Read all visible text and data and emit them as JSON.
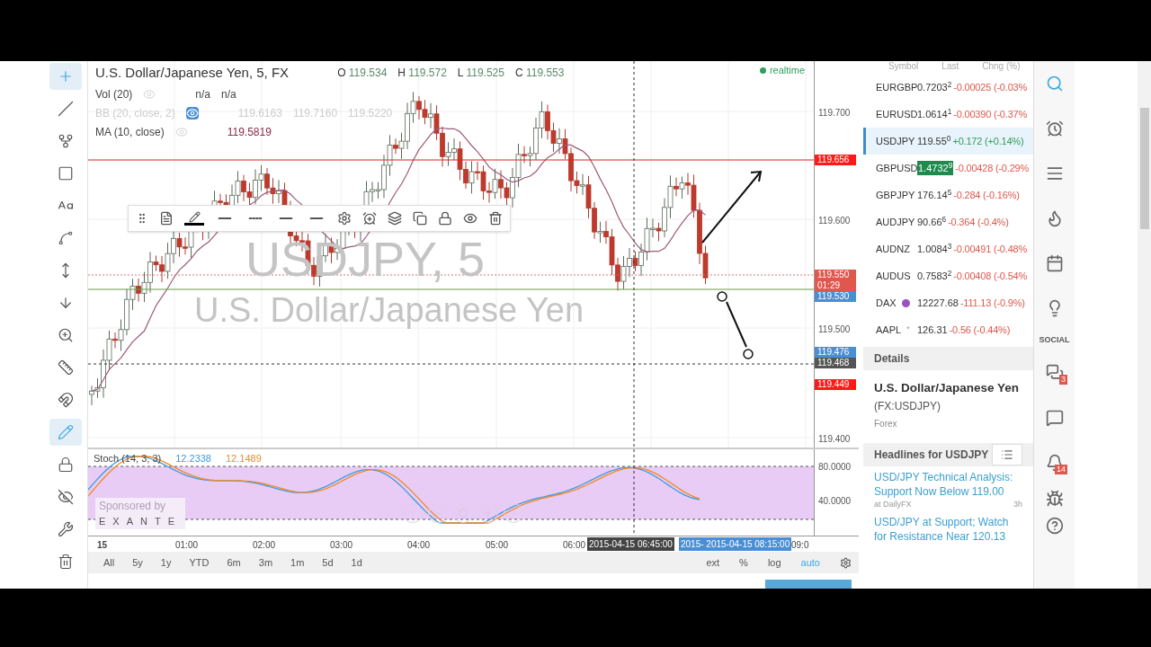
{
  "left_toolbar": [
    {
      "kind": "crosshair",
      "selected": true
    },
    {
      "kind": "trend-line",
      "selected": false
    },
    {
      "kind": "pitchfork",
      "selected": false
    },
    {
      "kind": "rectangle",
      "selected": false
    },
    {
      "kind": "text",
      "selected": false
    },
    {
      "kind": "pattern",
      "selected": false
    },
    {
      "kind": "measure",
      "selected": false
    },
    {
      "kind": "arrow-down",
      "selected": false
    },
    {
      "kind": "zoom",
      "selected": false
    },
    {
      "kind": "ruler",
      "selected": false
    },
    {
      "kind": "magnet",
      "selected": false
    },
    {
      "kind": "draw-mode",
      "selected": true
    },
    {
      "kind": "lock",
      "selected": false
    },
    {
      "kind": "hide",
      "selected": false
    },
    {
      "kind": "tools",
      "selected": false
    },
    {
      "kind": "trash",
      "selected": false
    }
  ],
  "chart": {
    "title": "U.S. Dollar/Japanese Yen, 5, FX",
    "ohlc": [
      {
        "label": "O",
        "value": "119.534"
      },
      {
        "label": "H",
        "value": "119.572"
      },
      {
        "label": "L",
        "value": "119.525"
      },
      {
        "label": "C",
        "value": "119.553"
      }
    ],
    "status": "realtime",
    "indicators": [
      {
        "name": "Vol (20)",
        "values": [
          "n/a",
          "n/a"
        ],
        "visible": true
      },
      {
        "name": "BB (20, close, 2)",
        "values": [
          "119.6163",
          "119.7160",
          "119.5220"
        ],
        "visible": false
      },
      {
        "name": "MA (10, close)",
        "values": [
          "119.5819"
        ],
        "visible": true
      }
    ],
    "background_symbol": "USDJPY, 5",
    "background_name": "U.S. Dollar/Japanese Yen",
    "price_ticks": [
      "119.700",
      "119.600",
      "119.500",
      "119.400"
    ],
    "price_tags": [
      {
        "value": "119.656",
        "color": "#ff1a1a"
      },
      {
        "value": "119.550",
        "color": "#e0574d"
      },
      {
        "value": "01:29",
        "color": "#e0574d"
      },
      {
        "value": "119.530",
        "color": "#4a8fd6"
      },
      {
        "value": "119.476",
        "color": "#4a8fd6"
      },
      {
        "value": "119.468",
        "color": "#555555"
      },
      {
        "value": "119.449",
        "color": "#ff1a1a"
      }
    ]
  },
  "oscillator": {
    "name": "Stoch (14, 3, 3)",
    "values": [
      {
        "value": "12.2338",
        "color": "#3d9bdc"
      },
      {
        "value": "12.1489",
        "color": "#f08a24"
      }
    ],
    "ticks": [
      "80.0000",
      "40.0000"
    ],
    "sponsor_label": "Sponsored by",
    "sponsor_name": "EXANTE"
  },
  "time_axis": {
    "labels": [
      "15",
      "01:00",
      "02:00",
      "03:00",
      "04:00",
      "05:00",
      "06:00",
      "09:0"
    ],
    "crosshair_time": "2015-04-15 06:45:00",
    "range_time": "2015- 2015-04-15 08:15:00"
  },
  "ranges": [
    {
      "label": "All",
      "selected": false
    },
    {
      "label": "5y",
      "selected": false
    },
    {
      "label": "1y",
      "selected": false
    },
    {
      "label": "YTD",
      "selected": false
    },
    {
      "label": "6m",
      "selected": false
    },
    {
      "label": "3m",
      "selected": false
    },
    {
      "label": "1m",
      "selected": false
    },
    {
      "label": "5d",
      "selected": false
    },
    {
      "label": "1d",
      "selected": false
    }
  ],
  "scale_options": [
    {
      "label": "ext",
      "selected": false
    },
    {
      "label": "%",
      "selected": false
    },
    {
      "label": "log",
      "selected": false
    },
    {
      "label": "auto",
      "selected": true
    }
  ],
  "watchlist": {
    "columns": [
      "Symbol",
      "Last",
      "Chng (%)"
    ],
    "rows": [
      {
        "symbol": "EURGBP",
        "last": "0.7203$^{2}$",
        "change": "-0.00025 (-0.03%",
        "color": "#e0574d",
        "selected": false,
        "highlighted": false
      },
      {
        "symbol": "EURUSD",
        "last": "1.0614$^{1}$",
        "change": "-0.00390 (-0.37%",
        "color": "#e0574d",
        "selected": false,
        "highlighted": false
      },
      {
        "symbol": "USDJPY",
        "last": "119.55$^{0}$",
        "change": "+0.172 (+0.14%)",
        "color": "#2e9e5a",
        "selected": true,
        "highlighted": false
      },
      {
        "symbol": "GBPUSD",
        "last": "1.4732$^{9}$",
        "change": "-0.00428 (-0.29%",
        "color": "#e0574d",
        "selected": false,
        "highlighted": true
      },
      {
        "symbol": "GBPJPY",
        "last": "176.14$^{5}$",
        "change": "-0.284 (-0.16%)",
        "color": "#e0574d",
        "selected": false,
        "highlighted": false
      },
      {
        "symbol": "AUDJPY",
        "last": "90.66$^{6}$",
        "change": "-0.364 (-0.4%)",
        "color": "#e0574d",
        "selected": false,
        "highlighted": false
      },
      {
        "symbol": "AUDNZ",
        "last": "1.0084$^{3}$",
        "change": "-0.00491 (-0.48%",
        "color": "#e0574d",
        "selected": false,
        "highlighted": false
      },
      {
        "symbol": "AUDUS",
        "last": "0.7583$^{2}$",
        "change": "-0.00408 (-0.54%",
        "color": "#e0574d",
        "selected": false,
        "highlighted": false
      },
      {
        "symbol": "DAX",
        "last": "12227.68",
        "change": "-111.13 (-0.9%)",
        "color": "#e0574d",
        "selected": false,
        "highlighted": false,
        "kind": "badge"
      },
      {
        "symbol": "AAPL",
        "last": "126.31",
        "change": "-0.56 (-0.44%)",
        "color": "#e0574d",
        "selected": false,
        "highlighted": false,
        "kind": "asterisk",
        "mark": "*"
      }
    ]
  },
  "details": {
    "heading": "Details",
    "name": "U.S. Dollar/Japanese Yen",
    "ticker": "(FX:USDJPY)",
    "category": "Forex"
  },
  "headlines": {
    "heading": "Headlines for USDJPY",
    "items": [
      {
        "title": "USD/JPY Technical Analysis: Support Now Below 119.00",
        "source": "at DailyFX",
        "age": "3h"
      },
      {
        "title": "USD/JPY at Support; Watch for Resistance Near 120.13"
      }
    ]
  },
  "side_icons": [
    {
      "kind": "search"
    },
    {
      "kind": "alarm"
    },
    {
      "kind": "list"
    },
    {
      "kind": "fire"
    },
    {
      "kind": "calendar"
    },
    {
      "kind": "bulb"
    },
    {
      "kind": "label",
      "text": "SOCIAL"
    },
    {
      "kind": "chats",
      "badge": "3"
    },
    {
      "kind": "chat"
    },
    {
      "kind": "bell",
      "badge": "14"
    },
    {
      "kind": "bug"
    },
    {
      "kind": "help"
    }
  ]
}
